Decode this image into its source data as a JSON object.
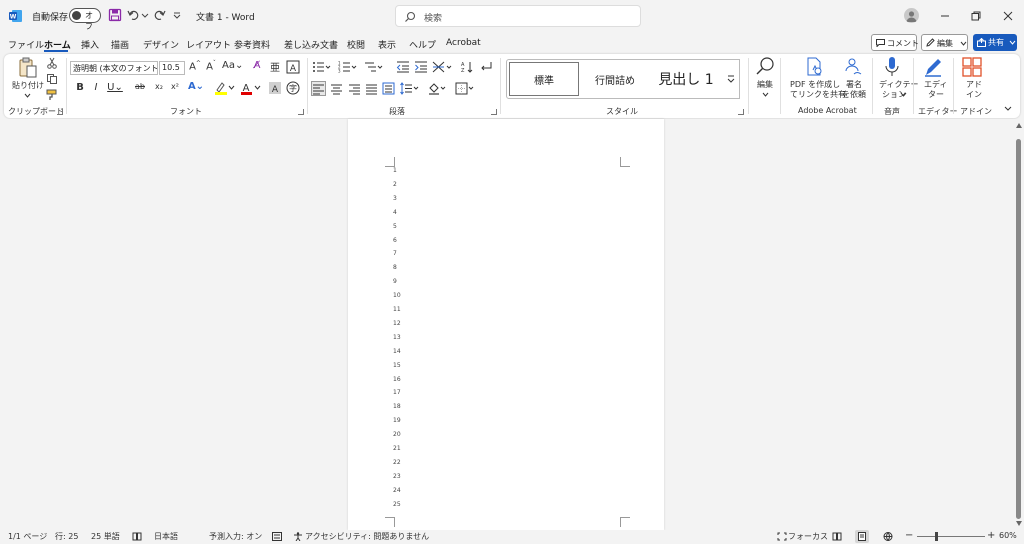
{
  "titlebar": {
    "autosave_label": "自動保存",
    "autosave_state": "オフ",
    "doc_title": "文書 1 - Word",
    "search_placeholder": "検索"
  },
  "tabs": [
    "ファイル",
    "ホーム",
    "挿入",
    "描画",
    "デザイン",
    "レイアウト",
    "参考資料",
    "差し込み文書",
    "校閲",
    "表示",
    "ヘルプ",
    "Acrobat"
  ],
  "active_tab": "ホーム",
  "actions": {
    "comment": "コメント",
    "edit": "編集",
    "share": "共有"
  },
  "ribbon": {
    "clipboard": {
      "paste": "貼り付け",
      "label": "クリップボード"
    },
    "font": {
      "name": "游明朝 (本文のフォント",
      "size": "10.5",
      "label": "フォント"
    },
    "paragraph": {
      "label": "段落"
    },
    "styles": {
      "items": [
        "標準",
        "行間詰め",
        "見出し 1"
      ],
      "label": "スタイル"
    },
    "editing": {
      "label": "編集"
    },
    "acrobat": {
      "create_pdf": "PDF を作成し",
      "create_pdf2": "てリンクを共有",
      "sign": "署名",
      "sign2": "を依頼",
      "label": "Adobe Acrobat"
    },
    "voice": {
      "dictation": "ディクテー",
      "dictation2": "ション",
      "label": "音声"
    },
    "editor": {
      "name": "エディ",
      "name2": "ター",
      "label": "エディター"
    },
    "addins": {
      "name": "アド",
      "name2": "イン",
      "label": "アドイン"
    }
  },
  "document": {
    "line_numbers": [
      "1",
      "2",
      "3",
      "4",
      "5",
      "6",
      "7",
      "8",
      "9",
      "10",
      "11",
      "12",
      "13",
      "14",
      "15",
      "16",
      "17",
      "18",
      "19",
      "20",
      "21",
      "22",
      "23",
      "24",
      "25"
    ]
  },
  "statusbar": {
    "page": "1/1 ページ",
    "line": "行: 25",
    "words": "25 単語",
    "language": "日本語",
    "predictive": "予測入力: オン",
    "accessibility": "アクセシビリティ: 問題ありません",
    "focus": "フォーカス",
    "zoom": "60%"
  },
  "colors": {
    "accent": "#185abd",
    "word_blue": "#185abd"
  }
}
